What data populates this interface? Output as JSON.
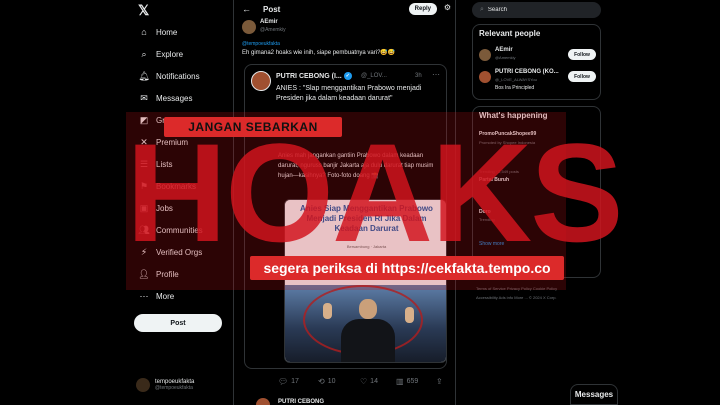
{
  "nav": {
    "items": [
      {
        "label": "Home",
        "icon": "home-icon"
      },
      {
        "label": "Explore",
        "icon": "search-icon"
      },
      {
        "label": "Notifications",
        "icon": "bell-icon"
      },
      {
        "label": "Messages",
        "icon": "mail-icon"
      },
      {
        "label": "Grok",
        "icon": "grok-icon"
      },
      {
        "label": "Premium",
        "icon": "x-icon"
      },
      {
        "label": "Lists",
        "icon": "list-icon"
      },
      {
        "label": "Bookmarks",
        "icon": "bookmark-icon"
      },
      {
        "label": "Jobs",
        "icon": "briefcase-icon"
      },
      {
        "label": "Communities",
        "icon": "people-icon"
      },
      {
        "label": "Verified Orgs",
        "icon": "lightning-icon"
      },
      {
        "label": "Profile",
        "icon": "user-icon"
      },
      {
        "label": "More",
        "icon": "more-icon"
      }
    ],
    "post_label": "Post",
    "account_name": "tempoeukfakta",
    "account_handle": "@tempoeukfakta"
  },
  "header": {
    "title": "Post",
    "reply_label": "Reply"
  },
  "reply": {
    "name": "AEmir",
    "handle": "@Amemkiy",
    "replying_to": "@tempoeukfakta",
    "text": "Eh gimana2 hoaks wie inih, siape pembuatnya vari?😅😅"
  },
  "quoted": {
    "name": "PUTRI CEBONG (I...",
    "handle": "@_LOV...",
    "time": "3h",
    "text1": "ANIES : \"Slap menggantikan Prabowo menjadi Presiden jika dalam keadaan darurat\"",
    "text2": "Anies mah jangankan gantiin Prabowo dalam keadaan darurat, nguruss banjir Jakarta aja dulu darurat tiap musim hujan—kasihnya? Foto-foto doang 📸",
    "img_title": "Anies Siap Menggantikan Prabowo Menjadi Presiden RI Jika Dalam Keadaan Darurat",
    "img_meta": "Bersambung · Jakarta"
  },
  "actions": {
    "replies": "17",
    "reposts": "10",
    "likes": "14",
    "views": "659"
  },
  "next_tweet": {
    "name": "PUTRI CEBONG"
  },
  "search": {
    "placeholder": "Search",
    "value": "Search"
  },
  "relevant": {
    "title": "Relevant people",
    "people": [
      {
        "name": "AEmir",
        "handle": "@Amemkiy",
        "bio": "",
        "follow": "Follow"
      },
      {
        "name": "PUTRI CEBONG (KO...",
        "handle": "@_LOVE_ALWAYSYou",
        "bio": "Bos Ira Principled",
        "follow": "Follow"
      }
    ]
  },
  "happening": {
    "title": "What's happening",
    "trends": [
      {
        "tag": "PromoPuncakShopee99",
        "meta": "Promoted by Shopee Indonesia"
      },
      {
        "tag": "Partai Buruh",
        "meta": "Trending · 2,549 posts"
      },
      {
        "tag": "Doro",
        "meta": "Trending"
      },
      {
        "tag": "Show more",
        "meta": ""
      }
    ],
    "show_more": "Show more"
  },
  "footer": {
    "line1": "Terms of Service  Privacy Policy  Cookie Policy",
    "line2": "Accessibility  Ads info  More ...  © 2024 X Corp."
  },
  "messages_label": "Messages",
  "overlay": {
    "top_banner": "JANGAN SEBARKAN",
    "stamp": "HOAKS",
    "bottom_banner": "segera periksa di https://cekfakta.tempo.co",
    "color": "#d92e2a"
  }
}
